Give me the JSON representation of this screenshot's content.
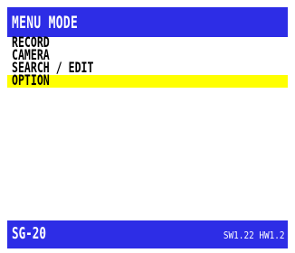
{
  "title_bar": {
    "title": "MENU MODE"
  },
  "menu": {
    "items": [
      {
        "label": "RECORD",
        "selected": false
      },
      {
        "label": "CAMERA",
        "selected": false
      },
      {
        "label": "SEARCH / EDIT",
        "selected": false
      },
      {
        "label": "OPTION",
        "selected": true
      }
    ]
  },
  "status_bar": {
    "model": "SG-20",
    "version": "SW1.22 HW1.2"
  },
  "colors": {
    "bar_blue": "#2d2de6",
    "highlight_yellow": "#ffff00",
    "background": "#ffffff"
  }
}
